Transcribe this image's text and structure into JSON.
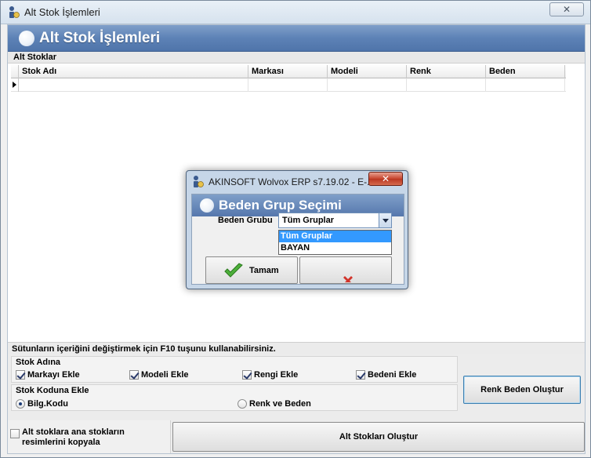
{
  "window": {
    "title": "Alt Stok İşlemleri",
    "close_label": "✕"
  },
  "banner": {
    "title": "Alt Stok İşlemleri"
  },
  "alt_stoklar": {
    "label": "Alt Stoklar",
    "columns": [
      "Stok Adı",
      "Markası",
      "Modeli",
      "Renk",
      "Beden"
    ]
  },
  "hint": "Sütunların içeriğini değiştirmek için F10 tuşunu kullanabilirsiniz.",
  "stok_adina": {
    "title": "Stok Adına",
    "options": [
      {
        "label": "Markayı Ekle",
        "checked": true
      },
      {
        "label": "Modeli Ekle",
        "checked": true
      },
      {
        "label": "Rengi Ekle",
        "checked": true
      },
      {
        "label": "Bedeni Ekle",
        "checked": true
      }
    ]
  },
  "stok_koduna": {
    "title": "Stok Koduna Ekle",
    "options": [
      {
        "label": "Bilg.Kodu",
        "checked": true
      },
      {
        "label": "Renk ve Beden",
        "checked": false
      }
    ]
  },
  "buttons": {
    "renk_beden": "Renk Beden Oluştur",
    "alt_stok_olustur": "Alt Stokları Oluştur"
  },
  "copy_option": {
    "label_line1": "Alt stoklara ana stokların",
    "label_line2": "resimlerini kopyala",
    "checked": false
  },
  "dialog": {
    "title": "AKINSOFT Wolvox ERP s7.19.02 - E-...",
    "close_label": "✕",
    "banner": "Beden Grup Seçimi",
    "field_label": "Beden Grubu",
    "selected": "Tüm Gruplar",
    "options": [
      "Tüm Gruplar",
      "BAYAN"
    ],
    "ok_label": "Tamam"
  },
  "colors": {
    "banner": "#5d82b6",
    "selection": "#3399ff",
    "dialog_close": "#c7432c"
  }
}
